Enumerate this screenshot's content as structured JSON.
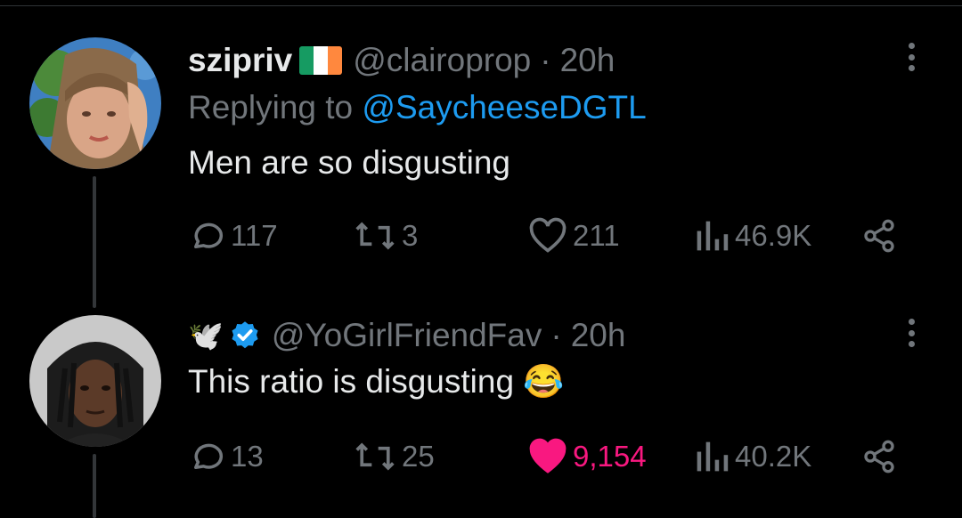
{
  "tweets": [
    {
      "display_name": "szipriv",
      "handle": "@clairoprop",
      "sep": "·",
      "time": "20h",
      "replying_prefix": "Replying to",
      "replying_to": "@SaycheeseDGTL",
      "text": "Men are so disgusting",
      "replies": "117",
      "retweets": "3",
      "likes": "211",
      "views": "46.9K",
      "liked": false,
      "flag_icon": "ireland-flag-icon"
    },
    {
      "display_name_emoji": "🕊️",
      "verified_icon": "verified-badge-icon",
      "handle": "@YoGirlFriendFav",
      "sep": "·",
      "time": "20h",
      "text": "This ratio is disgusting 😂",
      "replies": "13",
      "retweets": "25",
      "likes": "9,154",
      "views": "40.2K",
      "liked": true
    }
  ],
  "colors": {
    "background": "#000000",
    "text": "#e7e9ea",
    "muted": "#71767b",
    "link": "#1d9bf0",
    "like_active": "#f91880",
    "thread_line": "#333639"
  }
}
